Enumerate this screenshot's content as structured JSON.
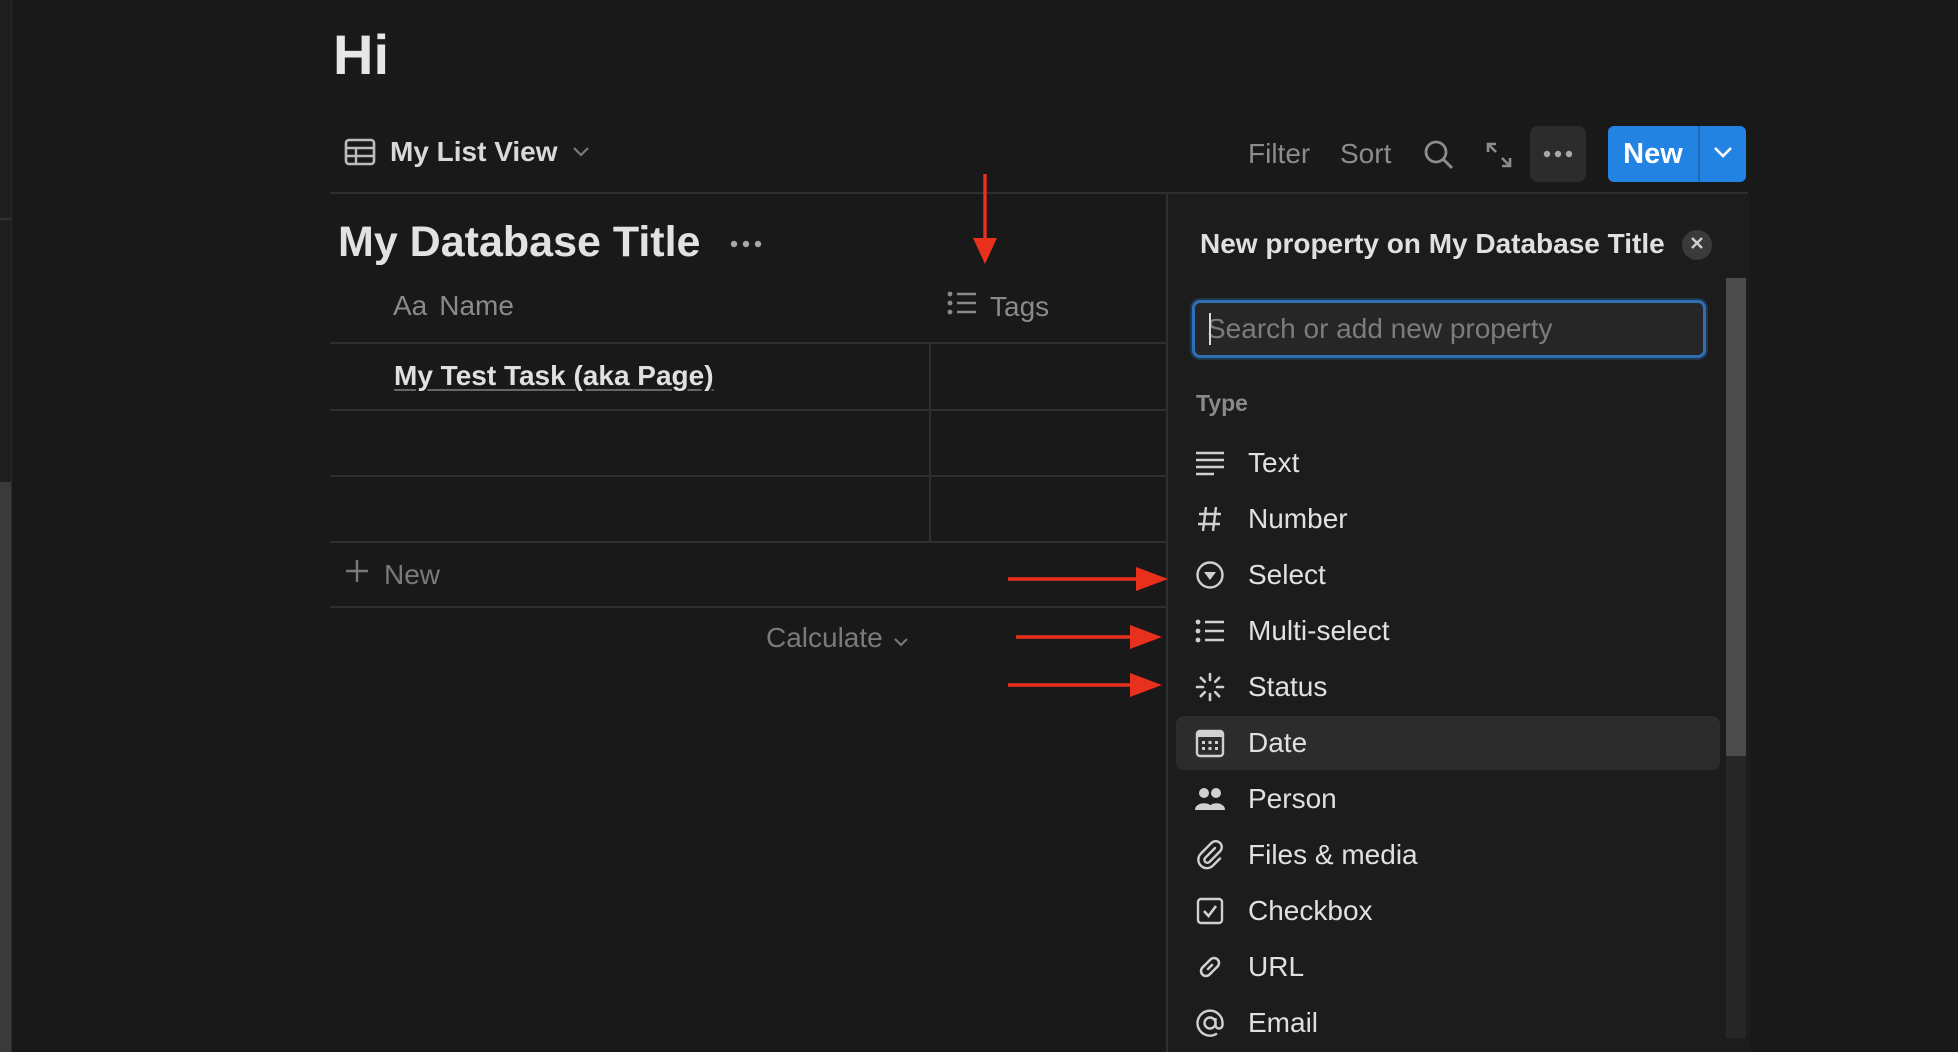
{
  "page": {
    "title": "Hi"
  },
  "viewbar": {
    "view_name": "My List View",
    "filter_label": "Filter",
    "sort_label": "Sort",
    "new_label": "New",
    "icons": [
      "table-icon",
      "chevron-down-icon",
      "search-icon",
      "expand-icon",
      "more-icon"
    ]
  },
  "database": {
    "title": "My Database Title",
    "columns": [
      {
        "label": "Name",
        "prefix": "Aa"
      },
      {
        "label": "Tags",
        "icon": "list-icon"
      }
    ],
    "rows": [
      {
        "name": "My Test Task (aka Page)",
        "tags": ""
      },
      {
        "name": "",
        "tags": ""
      },
      {
        "name": "",
        "tags": ""
      }
    ],
    "add_row_label": "New",
    "calculate_label": "Calculate"
  },
  "panel": {
    "title": "New property on My Database Title",
    "search_placeholder": "Search or add new property",
    "section_label": "Type",
    "types": [
      {
        "label": "Text",
        "icon": "text-lines-icon"
      },
      {
        "label": "Number",
        "icon": "hash-icon"
      },
      {
        "label": "Select",
        "icon": "select-circle-icon"
      },
      {
        "label": "Multi-select",
        "icon": "list-icon"
      },
      {
        "label": "Status",
        "icon": "status-spinner-icon"
      },
      {
        "label": "Date",
        "icon": "calendar-icon",
        "hovered": true
      },
      {
        "label": "Person",
        "icon": "people-icon"
      },
      {
        "label": "Files & media",
        "icon": "paperclip-icon"
      },
      {
        "label": "Checkbox",
        "icon": "checkbox-icon"
      },
      {
        "label": "URL",
        "icon": "link-icon"
      },
      {
        "label": "Email",
        "icon": "at-icon"
      }
    ]
  },
  "annotations": {
    "arrow_color": "#e8301c"
  },
  "colors": {
    "background": "#191919",
    "accent": "#2383e2",
    "text": "#e0e0e0",
    "muted": "#8a8a8a"
  }
}
